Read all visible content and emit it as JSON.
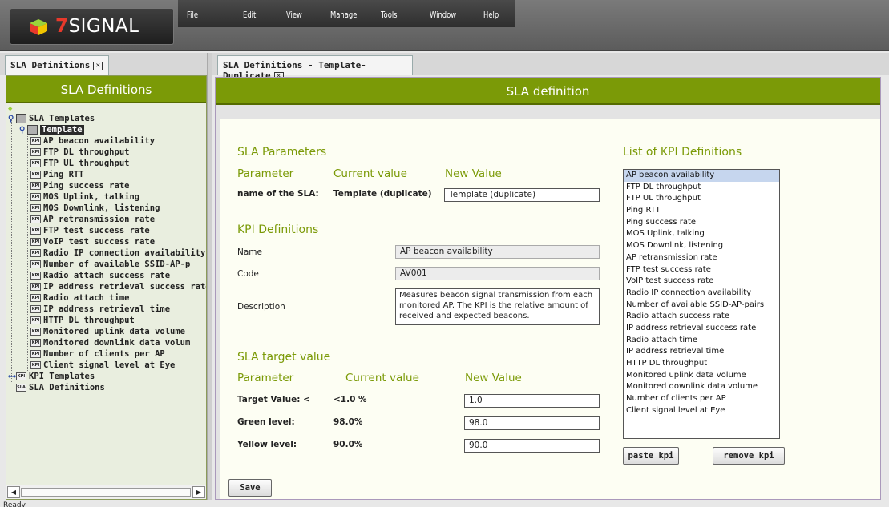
{
  "app": {
    "logo_text": "SIGNAL",
    "logo_prefix": "7"
  },
  "menu": [
    "File",
    "Edit",
    "View",
    "Manage",
    "Tools",
    "Window",
    "Help"
  ],
  "left": {
    "tab_label": "SLA Definitions",
    "header": "SLA Definitions",
    "tree": {
      "root": "SLA Templates",
      "template": "Template",
      "kpis": [
        "AP beacon availability",
        "FTP DL throughput",
        "FTP UL throughput",
        "Ping RTT",
        "Ping success rate",
        "MOS Uplink, talking",
        "MOS Downlink, listening",
        "AP retransmission rate",
        "FTP test success rate",
        "VoIP test success rate",
        "Radio IP connection availability",
        "Number of available SSID-AP-p",
        "Radio attach success rate",
        "IP address retrieval success rate",
        "Radio attach time",
        "IP address retrieval time",
        "HTTP DL throughput",
        "Monitored uplink data volume",
        "Monitored downlink data volum",
        "Number of clients per AP",
        "Client signal level at Eye"
      ],
      "kpi_templates": "KPI Templates",
      "sla_definitions": "SLA Definitions"
    },
    "kpi_badge": "KPI"
  },
  "right": {
    "tab_label": "SLA Definitions - Template-Duplicate",
    "header": "SLA definition",
    "sla_params": {
      "title": "SLA Parameters",
      "col_param": "Parameter",
      "col_current": "Current value",
      "col_new": "New Value",
      "name_label": "name of the SLA:",
      "name_current": "Template (duplicate)",
      "name_new": "Template (duplicate)"
    },
    "kpi_def": {
      "title": "KPI Definitions",
      "name_label": "Name",
      "name_value": "AP beacon availability",
      "code_label": "Code",
      "code_value": "AV001",
      "desc_label": "Description",
      "desc_value": "Measures beacon signal transmission from each monitored AP. The KPI is the relative amount of received and expected beacons."
    },
    "target": {
      "title": "SLA target value",
      "col_param": "Parameter",
      "col_current": "Current value",
      "col_new": "New Value",
      "rows": [
        {
          "label": "Target Value: <",
          "current": "<1.0 %",
          "new": "1.0"
        },
        {
          "label": "Green level:",
          "current": "98.0%",
          "new": "98.0"
        },
        {
          "label": "Yellow level:",
          "current": "90.0%",
          "new": "90.0"
        }
      ]
    },
    "kpi_list": {
      "title": "List of KPI Definitions",
      "items": [
        "AP beacon availability",
        "FTP DL throughput",
        "FTP UL throughput",
        "Ping RTT",
        "Ping success rate",
        "MOS Uplink, talking",
        "MOS Downlink, listening",
        "AP retransmission rate",
        "FTP test success rate",
        "VoIP test success rate",
        "Radio IP connection availability",
        "Number of available SSID-AP-pairs",
        "Radio attach success rate",
        "IP address retrieval success rate",
        "Radio attach time",
        "IP address retrieval time",
        "HTTP DL throughput",
        "Monitored uplink data volume",
        "Monitored downlink data volume",
        "Number of clients per AP",
        "Client signal level at Eye"
      ],
      "selected": "AP beacon availability"
    },
    "buttons": {
      "paste": "paste kpi",
      "remove": "remove kpi",
      "save": "Save"
    }
  },
  "status": "Ready"
}
